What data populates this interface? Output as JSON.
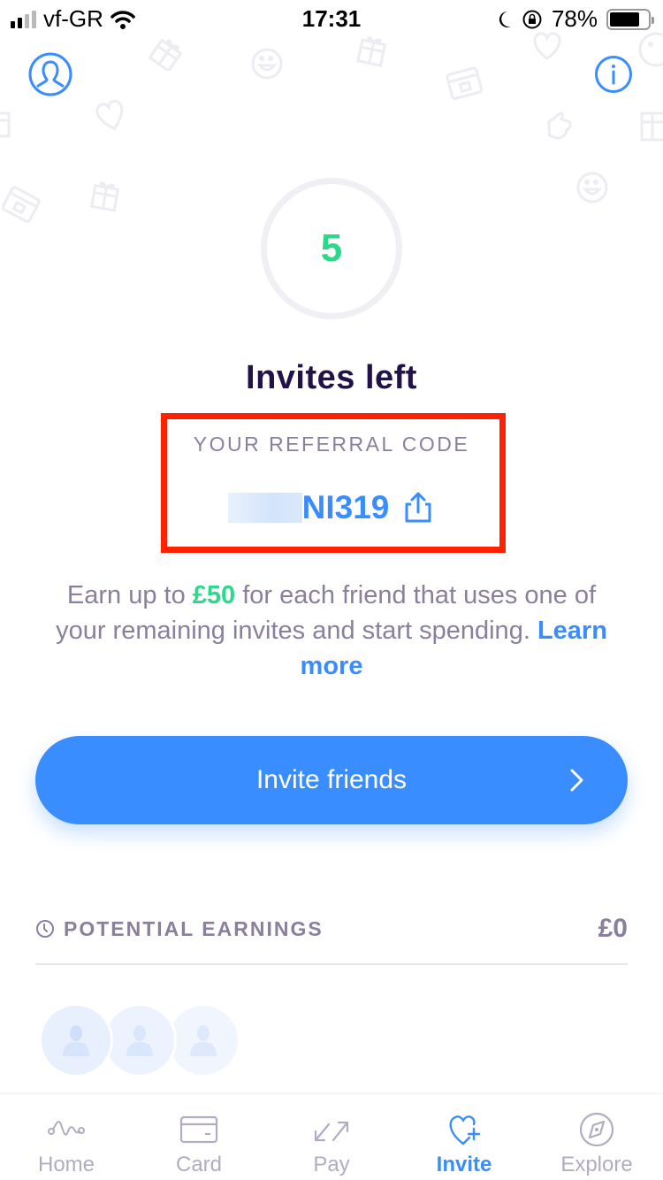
{
  "status_bar": {
    "carrier": "vf-GR",
    "time": "17:31",
    "battery": "78%",
    "battery_level": 0.78,
    "icons": [
      "signal-icon",
      "wifi-icon",
      "moon-icon",
      "rotation-lock-icon",
      "battery-icon"
    ]
  },
  "header": {
    "profile_icon": "profile-icon",
    "info_icon": "info-icon"
  },
  "invites": {
    "count": "5",
    "title": "Invites left"
  },
  "referral": {
    "label": "YOUR REFERRAL CODE",
    "code_visible": "NI319",
    "share_icon": "share-icon"
  },
  "description": {
    "prefix": "Earn up to ",
    "amount": "£50",
    "suffix": " for each friend that uses one of your remaining invites and start spending. ",
    "link": "Learn more"
  },
  "invite_button": {
    "label": "Invite friends"
  },
  "earnings": {
    "label": "POTENTIAL EARNINGS",
    "value": "£0"
  },
  "tabs": [
    {
      "label": "Home",
      "icon": "home-wave-icon",
      "active": false
    },
    {
      "label": "Card",
      "icon": "card-icon",
      "active": false
    },
    {
      "label": "Pay",
      "icon": "pay-arrows-icon",
      "active": false
    },
    {
      "label": "Invite",
      "icon": "heart-plus-icon",
      "active": true
    },
    {
      "label": "Explore",
      "icon": "compass-icon",
      "active": false
    }
  ],
  "colors": {
    "accent": "#3a8dff",
    "green": "#2bd98a",
    "title": "#22124a",
    "muted": "#8a809e",
    "highlight": "#ff2200"
  }
}
